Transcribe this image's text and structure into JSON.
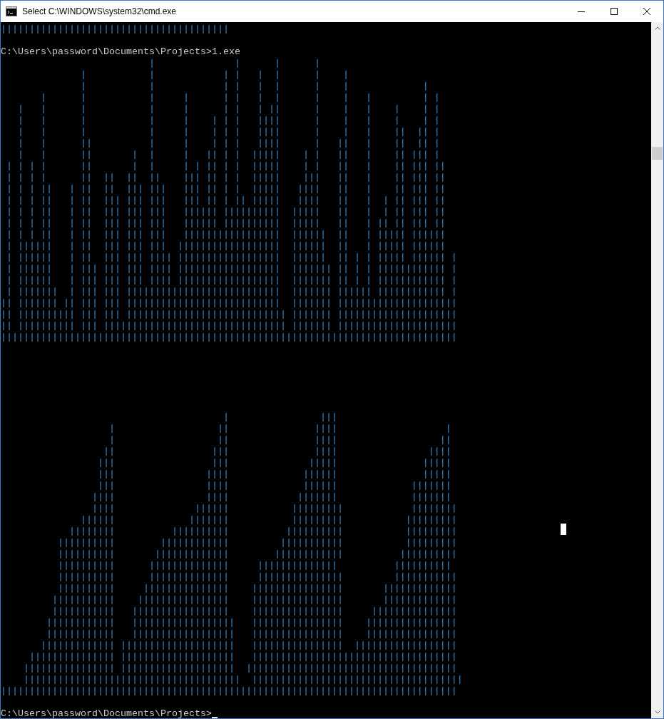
{
  "window": {
    "title": "Select C:\\WINDOWS\\system32\\cmd.exe"
  },
  "console": [
    {
      "kind": "output",
      "lines": [
        "||||||||||||||||||||||||||||||||||||||||"
      ]
    },
    {
      "kind": "blank"
    },
    {
      "kind": "prompt",
      "text": "C:\\Users\\password\\Documents\\Projects>1.exe",
      "cursor": false
    },
    {
      "kind": "output",
      "lines": [
        "                          |              |      |      |",
        "              |           |            | |   |  |      |    |",
        "              |           |            | |   |  |      |    |             |",
        "       |      |           |     |      | |   |  |      |    |   |         | |",
        "   |   |      |           |     |      | |   | ||      |    |   |    |    | |",
        "   |   |      |           |     |    | | |   ||||      |    |   |    |    | |",
        "   |   |      |           |     |    | | |   ||||      |    |   |    ||  || |",
        "   |   |      ||          |     |    | | |   ||||      |   ||   |    ||  || |",
        "   |   |      ||       |  |     |   || | |  |||||    | |   ||   |    || ||| |",
        " | | | |      ||       |  |     | | || | |  |||||    | |   ||   |    || ||| ||",
        " | | | |      ||  ||  ||  ||    ||| || | |  |||||    |||   ||   |    || ||| ||",
        " | | | ||   | ||  ||  ||| |||   ||| || | |  |||||   ||||   ||   |    || ||| ||",
        " | | | ||   | ||  ||| ||| |||   ||| || | || |||||   ||||   ||   |  | || ||| ||",
        " | | | ||   | ||  ||| ||| |||   |||||| ||||||||||  |||||   ||   |  | || ||| ||",
        " | | | ||   | ||  ||| ||| |||   |||||| ||||||||||  |||||   ||   | || || ||| ||",
        " | | | ||   | ||  ||| ||| |||   |||||||||||||||||  ||||||  ||   | ||||| ||||||",
        " | ||||||   | ||  ||| ||| |||  ||||||||||||||||||  ||||||  ||   | ||||| ||||||",
        " | ||||||   | ||  ||| ||| |||| ||||||||||||||||||  ||||||  || | | ||||| |||||| |",
        " | ||||||   | ||| ||| ||| |||| ||||||||||||||||||  ||||||| || | | |||||||||||| |",
        " | ||||||   | ||| ||| ||| |||| ||||||||||||||||||  ||||||| || | | |||||||||||| |",
        " | |||||||  | ||| ||| |||||||||||||||||||||||||||  ||||||| |||||| |||||||||||| |",
        "|| ||||||| || ||| ||| |||||||||||||||||||||||||||  ||||||| |||||||||||||||||||||",
        "|| |||||||||| ||| ||| |||||||||||||||||||||||||||| ||||||| |||||||||||||||||||||",
        "|| |||||||||| ||| |||||||||||||||||||||||||||||||| ||||||| |||||||||||||||||||||",
        "||||||||||||||||||||||||||||||||||||||||||||||||||||||||||||||||||||||||||||||||"
      ]
    },
    {
      "kind": "blank"
    },
    {
      "kind": "blank"
    },
    {
      "kind": "blank"
    },
    {
      "kind": "blank"
    },
    {
      "kind": "blank"
    },
    {
      "kind": "blank"
    },
    {
      "kind": "output",
      "lines": [
        "                                       |                |||",
        "                   |                  ||               ||||                   |",
        "                   |                  ||               ||||                  ||",
        "                  ||                 |||               ||||                ||||",
        "                 |||                 |||              |||||               |||||",
        "                 |||                ||||             ||||||               |||||",
        "                 |||                ||||             ||||||             |||||||",
        "                ||||                ||||            |||||||             |||||||",
        "                ||||              ||||||           |||||||||            ||||||||",
        "              ||||||             |||||||           |||||||||           |||||||||",
        "            ||||||||          ||||||||||          ||||||||||           |||||||||",
        "          ||||||||||        ||||||||||||         |||||||||||           |||||||||",
        "          ||||||||||       |||||||||||||        ||||||||||||          ||||||||||",
        "          ||||||||||      ||||||||||||||     ||||||||||||||          ||||||||||",
        "          ||||||||||      ||||||||||||||     |||||||||||||||         |||||||||||",
        "          ||||||||||     |||||||||||||||    ||||||||||||||||       |||||||||||||",
        "         |||||||||||    ||||||||||||||||    ||||||||||||||||       |||||||||||||",
        "         |||||||||||   |||||||||||||||||    ||||||||||||||||     |||||||||||||||",
        "        ||||||||||||   ||||||||||||||||||   ||||||||||||||||    ||||||||||||||||",
        "        ||||||||||||   ||||||||||||||||||   ||||||||||||||||    ||||||||||||||||",
        "       ||||||||||||| ||||||||||||||||||||   ||||||||||||||||  ||||||||||||||||||",
        "     ||||||||||||||| ||||||||||||||||||||   ||||||||||||||||||||||||||||||||||||",
        "    |||||||||||||||| ||||||||||||||||||||  |||||||||||||||||||||||||||||||||||||",
        "    ||||||||||||||||||||||||||||||||||||||  |||||||||||||||||||||||||||||||||||||",
        "||||||||||||||||||||||||||||||||||||||||||||||||||||||||||||||||||||||||||||||||"
      ]
    },
    {
      "kind": "blank"
    },
    {
      "kind": "prompt",
      "text": "C:\\Users\\password\\Documents\\Projects>",
      "cursor": true
    }
  ]
}
